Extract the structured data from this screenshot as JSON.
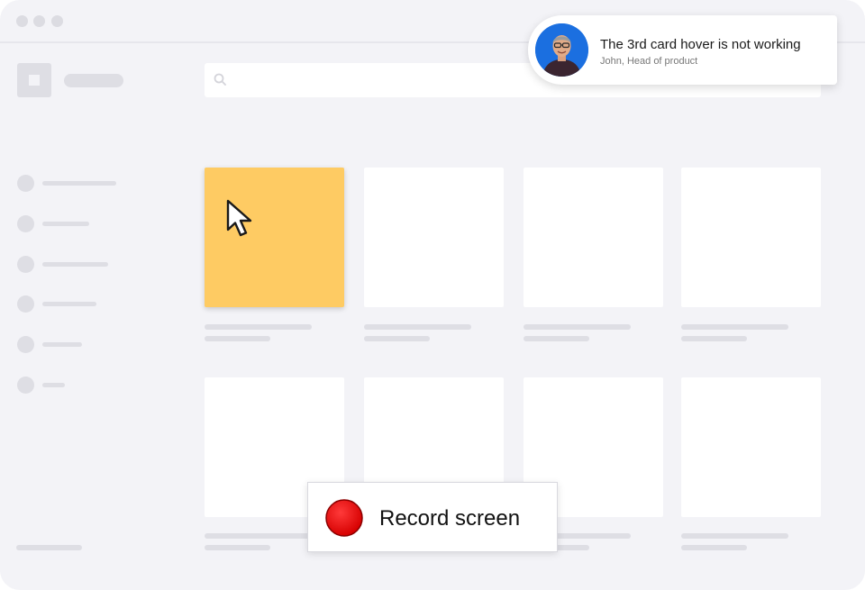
{
  "window": {
    "controls": [
      "close",
      "minimize",
      "maximize"
    ]
  },
  "search": {
    "icon": "search-icon",
    "value": ""
  },
  "sidebar": {
    "item_count": 6
  },
  "cards": {
    "hovered_index": 0,
    "hover_color": "#fecb63",
    "card_color": "#ffffff",
    "count": 8
  },
  "notification": {
    "title": "The 3rd card hover is not working",
    "subtitle": "John, Head of product",
    "avatar_bg": "#1b6fe0"
  },
  "recorder": {
    "label": "Record screen",
    "button_color": "#e60000",
    "icon": "record-icon"
  },
  "colors": {
    "background": "#f3f3f7",
    "placeholder": "#dedee4"
  }
}
